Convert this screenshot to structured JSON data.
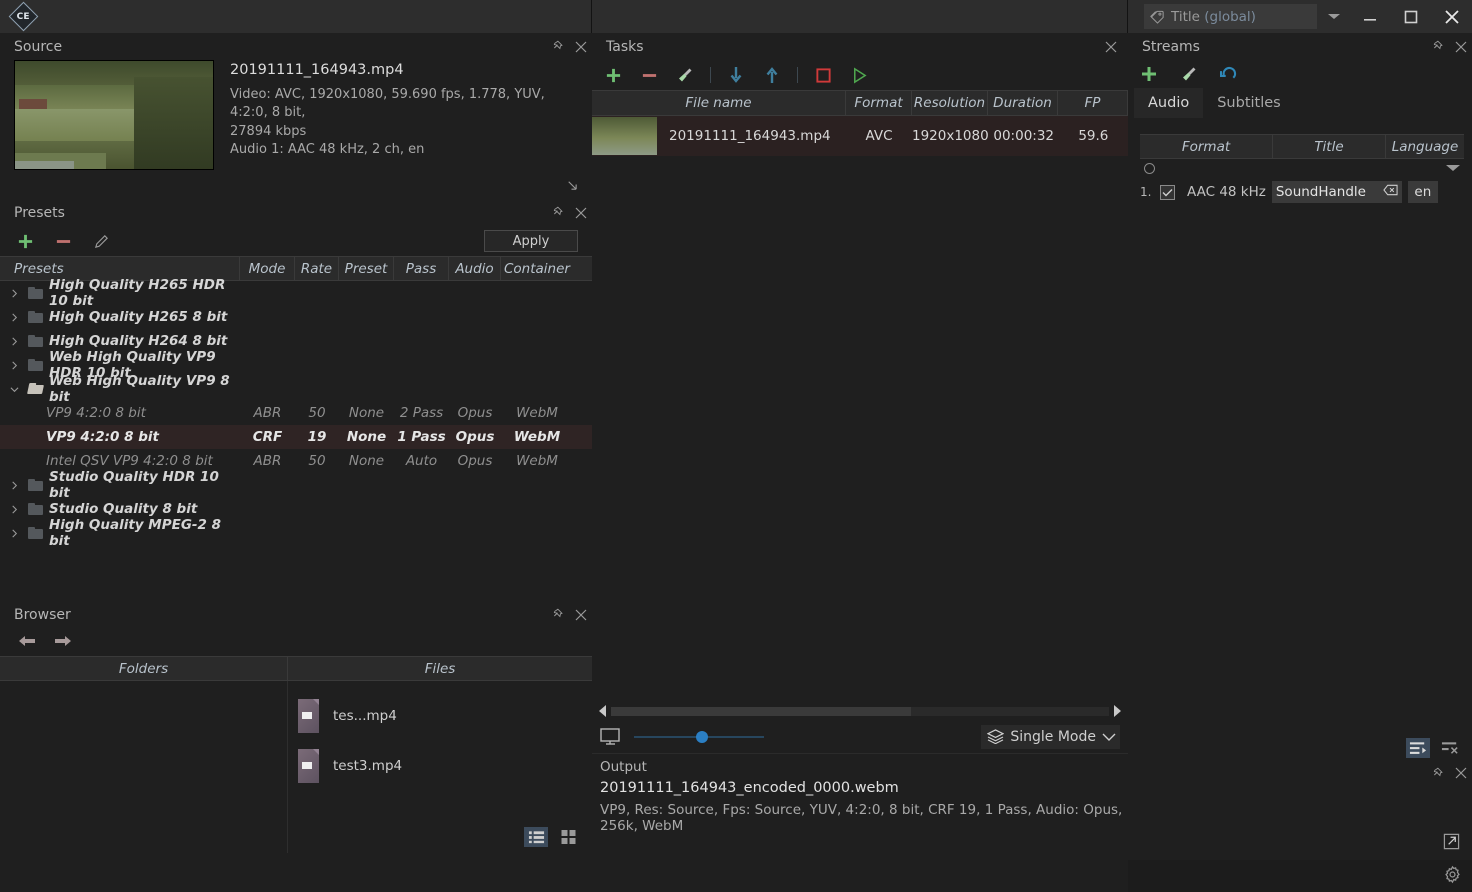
{
  "app": {
    "logo_text": "CE"
  },
  "titlebar": {
    "title_field_label": "Title",
    "title_field_scope": "(global)",
    "minimize": "minimize",
    "maximize": "maximize",
    "close": "close"
  },
  "source": {
    "panel_title": "Source",
    "file_name": "20191111_164943.mp4",
    "video_line1": "Video: AVC, 1920x1080, 59.690 fps, 1.778, YUV, 4:2:0, 8 bit,",
    "video_line2": "27894 kbps",
    "audio_line": "Audio 1: AAC  48 kHz, 2 ch, en"
  },
  "presets": {
    "panel_title": "Presets",
    "apply_label": "Apply",
    "columns": [
      "Presets",
      "Mode",
      "Rate",
      "Preset",
      "Pass",
      "Audio",
      "Container"
    ],
    "rows": [
      {
        "type": "group",
        "expanded": false,
        "name": "High Quality H265 HDR 10 bit",
        "mode": "",
        "rate": "",
        "preset": "",
        "pass": "",
        "audio": "",
        "container": ""
      },
      {
        "type": "group",
        "expanded": false,
        "name": "High Quality H265 8 bit",
        "mode": "",
        "rate": "",
        "preset": "",
        "pass": "",
        "audio": "",
        "container": ""
      },
      {
        "type": "group",
        "expanded": false,
        "name": "High Quality H264 8 bit",
        "mode": "",
        "rate": "",
        "preset": "",
        "pass": "",
        "audio": "",
        "container": ""
      },
      {
        "type": "group",
        "expanded": false,
        "name": "Web High Quality VP9 HDR 10 bit",
        "mode": "",
        "rate": "",
        "preset": "",
        "pass": "",
        "audio": "",
        "container": ""
      },
      {
        "type": "group",
        "expanded": true,
        "name": "Web High Quality VP9 8 bit",
        "mode": "",
        "rate": "",
        "preset": "",
        "pass": "",
        "audio": "",
        "container": ""
      },
      {
        "type": "child",
        "selected": false,
        "name": "VP9 4:2:0 8 bit",
        "mode": "ABR",
        "rate": "50",
        "preset": "None",
        "pass": "2 Pass",
        "audio": "Opus",
        "container": "WebM"
      },
      {
        "type": "child",
        "selected": true,
        "name": "VP9 4:2:0 8 bit",
        "mode": "CRF",
        "rate": "19",
        "preset": "None",
        "pass": "1 Pass",
        "audio": "Opus",
        "container": "WebM"
      },
      {
        "type": "child",
        "selected": false,
        "name": "Intel QSV VP9 4:2:0 8 bit",
        "mode": "ABR",
        "rate": "50",
        "preset": "None",
        "pass": "Auto",
        "audio": "Opus",
        "container": "WebM"
      },
      {
        "type": "group",
        "expanded": false,
        "name": "Studio Quality HDR 10 bit",
        "mode": "",
        "rate": "",
        "preset": "",
        "pass": "",
        "audio": "",
        "container": ""
      },
      {
        "type": "group",
        "expanded": false,
        "name": "Studio Quality 8 bit",
        "mode": "",
        "rate": "",
        "preset": "",
        "pass": "",
        "audio": "",
        "container": ""
      },
      {
        "type": "group",
        "expanded": false,
        "name": "High Quality MPEG-2 8 bit",
        "mode": "",
        "rate": "",
        "preset": "",
        "pass": "",
        "audio": "",
        "container": ""
      }
    ]
  },
  "browser": {
    "panel_title": "Browser",
    "columns": [
      "Folders",
      "Files"
    ],
    "folders": [],
    "files": [
      {
        "name": "tes...mp4"
      },
      {
        "name": "test3.mp4"
      }
    ]
  },
  "tasks": {
    "panel_title": "Tasks",
    "columns": [
      "File name",
      "Format",
      "Resolution",
      "Duration",
      "FP"
    ],
    "rows": [
      {
        "file_name": "20191111_164943.mp4",
        "format": "AVC",
        "resolution": "1920x1080",
        "duration": "00:00:32",
        "fps": "59.6"
      }
    ]
  },
  "preview": {
    "mode_label": "Single Mode"
  },
  "output": {
    "panel_title": "Output",
    "file_name": "20191111_164943_encoded_0000.webm",
    "description": "VP9, Res: Source, Fps: Source, YUV, 4:2:0, 8 bit, CRF 19, 1 Pass, Audio: Opus, 256k, WebM"
  },
  "streams": {
    "panel_title": "Streams",
    "tabs": [
      {
        "label": "Audio",
        "active": true
      },
      {
        "label": "Subtitles",
        "active": false
      }
    ],
    "columns": [
      "Format",
      "Title",
      "Language"
    ],
    "rows": [
      {
        "index": "1.",
        "checked": true,
        "format": "AAC  48 kHz",
        "title": "SoundHandle",
        "language": "en"
      }
    ]
  },
  "colors": {
    "accent_green": "#5cb85c",
    "accent_red": "#c05a5a",
    "accent_blue": "#2b7fc4",
    "selection_row": "#2f2424",
    "panel_bg": "#1f1f1f",
    "header_bg": "#2b2b2b"
  }
}
